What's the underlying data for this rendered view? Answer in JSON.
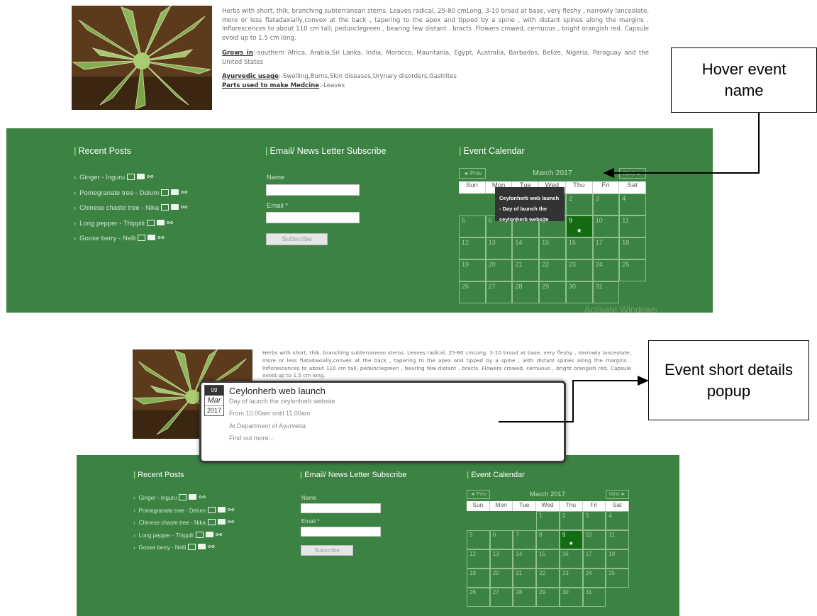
{
  "description": {
    "text": "Herbs with short, thik, branching subterranean  stems. Leaves radical, 25-80 cmLong, 3-10 broad at base, very fleshy , narrowly lanceolate, more or less flatadaxially,convex at the back , tapering to the apex and tipped by a spine , with distant spines along the margins . Inflorescences to about 110 cm tall; peduncl‌egreen , bearing few distant . bracts .Flowers crowed, cernuous , bright orangish red. Capsule ovoid up to 1.5 cm long.",
    "grows_label": "Grows in",
    "grows_value": ":-southern Africa, Arabia,Sri Lanka, India, Morocco, Mauritania, Egypt, Australia, Barbados, Belize, Nigeria, Paraguay and the United States",
    "usage_label": "Ayurvedic usage",
    "usage_value": ":-Swelling,Burns,Skin diseases,Urynary disorders,Gastrites",
    "parts_label": "Parts used to make Medcine",
    "parts_value": ":-Leaves"
  },
  "footer": {
    "recent_title": "Recent Posts",
    "newsletter_title": "Email/ News Letter Subscribe",
    "calendar_title": "Event Calendar",
    "posts": [
      "Ginger - Inguru",
      "Pomegranate tree - Delum",
      "Chinese chaste tree - Nika",
      "Long pepper - Thippili",
      "Goose berry - Nelli"
    ],
    "name_label": "Name",
    "email_label": "Email *",
    "subscribe_label": "Subscribe"
  },
  "calendar": {
    "prev": "◄ Prev",
    "next": "Next ►",
    "month": "March 2017",
    "days": [
      "Sun",
      "Mon",
      "Tue",
      "Wed",
      "Thu",
      "Fri",
      "Sat"
    ],
    "leading_blanks": 3,
    "day_count": 31,
    "event_day": 9,
    "event_star": "★"
  },
  "tooltip": {
    "text": "Ceylonherb web launch - Day of launch the ceylonherb website"
  },
  "popup": {
    "day": "09",
    "month": "Mar",
    "year": "2017",
    "title": "Ceylonherb web launch",
    "subtitle": "Day of launch the ceylonherb website",
    "time": "From 10.00am until 11.00am",
    "location": "At Department of Ayurveda",
    "more": "Find out more..."
  },
  "watermark": "Activate Windows",
  "callouts": {
    "hover": "Hover event name",
    "popup": "Event short details popup"
  },
  "colors": {
    "footer_green": "#3c8243",
    "event_green": "#136b13",
    "accent_bar": "#7dd97a",
    "tooltip_bg": "#333333"
  }
}
